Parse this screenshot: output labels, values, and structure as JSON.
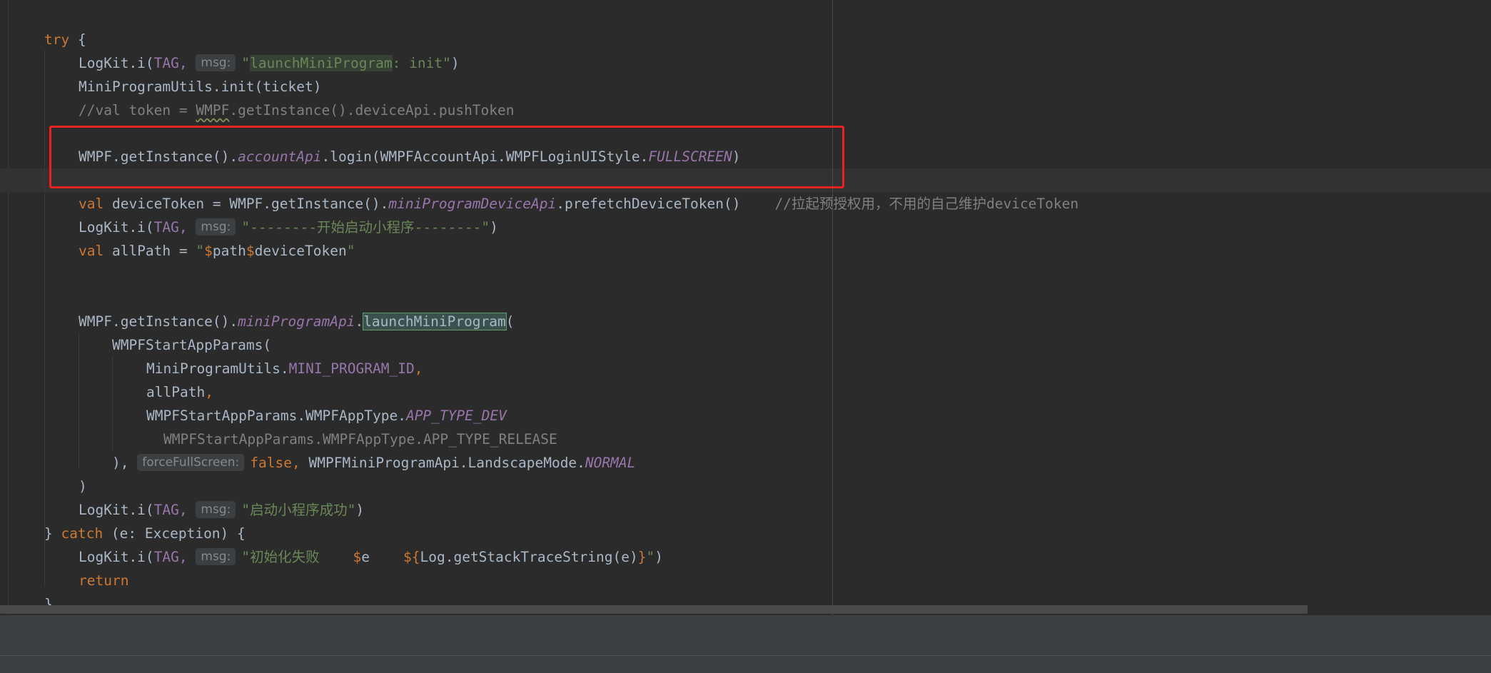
{
  "editor": {
    "lines": [
      {
        "kw": "try",
        "rest": " {"
      },
      {
        "call": "LogKit.i(",
        "tag": "TAG,",
        "hint": "msg:",
        "q": "\"",
        "hl": "launchMiniProgram",
        "tail": ": init\"",
        "close": ")"
      },
      {
        "text": "MiniProgramUtils.init(ticket)"
      },
      {
        "pre": "//val token = ",
        "warn": "WMPF",
        "post": ".getInstance().deviceApi.pushToken"
      },
      {
        "a": "WMPF.getInstance().",
        "prop": "accountApi",
        "b": ".login(WMPFAccountApi.WMPFLoginUIStyle.",
        "prop2": "FULLSCREEN",
        "c": ")"
      },
      {
        "kw": "val",
        "a": " deviceToken = WMPF.getInstance().",
        "prop": "miniProgramDeviceApi",
        "b": ".prefetchDeviceToken()",
        "comment": "//拉起预授权用，不用的自己维护deviceToken"
      },
      {
        "call": "LogKit.i(",
        "tag": "TAG,",
        "hint": "msg:",
        "str": "\"--------开始启动小程序--------\"",
        "close": ")"
      },
      {
        "kw": "val",
        "a": " allPath = ",
        "q1": "\"",
        "d1": "$",
        "v1": "path",
        "d2": "$",
        "v2": "deviceToken",
        "q2": "\""
      },
      {
        "a": "WMPF.getInstance().",
        "prop": "miniProgramApi",
        "dot": ".",
        "hl": "launchMiniProgram",
        "b": "("
      },
      {
        "text": "WMPFStartAppParams("
      },
      {
        "a": "MiniProgramUtils.",
        "const": "MINI_PROGRAM_ID",
        "comma": ","
      },
      {
        "a": "allPath",
        "comma": ","
      },
      {
        "a": "WMPFStartAppParams.WMPFAppType.",
        "prop": "APP_TYPE_DEV"
      },
      {
        "cmt": "WMPFStartAppParams.WMPFAppType.APP_TYPE_RELEASE"
      },
      {
        "a": "),",
        "hint": "forceFullScreen:",
        "kw": "false,",
        "b": " WMPFMiniProgramApi.LandscapeMode.",
        "prop": "NORMAL"
      },
      {
        "text": ")"
      },
      {
        "call": "LogKit.i(",
        "tag": "TAG,",
        "hint": "msg:",
        "str": "\"启动小程序成功\"",
        "close": ")"
      },
      {
        "a": "} ",
        "kw": "catch",
        "b": " (e: Exception) {"
      },
      {
        "call": "LogKit.i(",
        "tag": "TAG,",
        "hint": "msg:",
        "q": "\"",
        "s1": "初始化失败    ",
        "d1": "$",
        "v1": "e",
        "sp": "    ",
        "d2": "${",
        "v2": "Log.getStackTraceString(e)",
        "d3": "}",
        "q2": "\"",
        "close": ")"
      },
      {
        "kw": "return"
      },
      {
        "text": "}"
      }
    ]
  }
}
